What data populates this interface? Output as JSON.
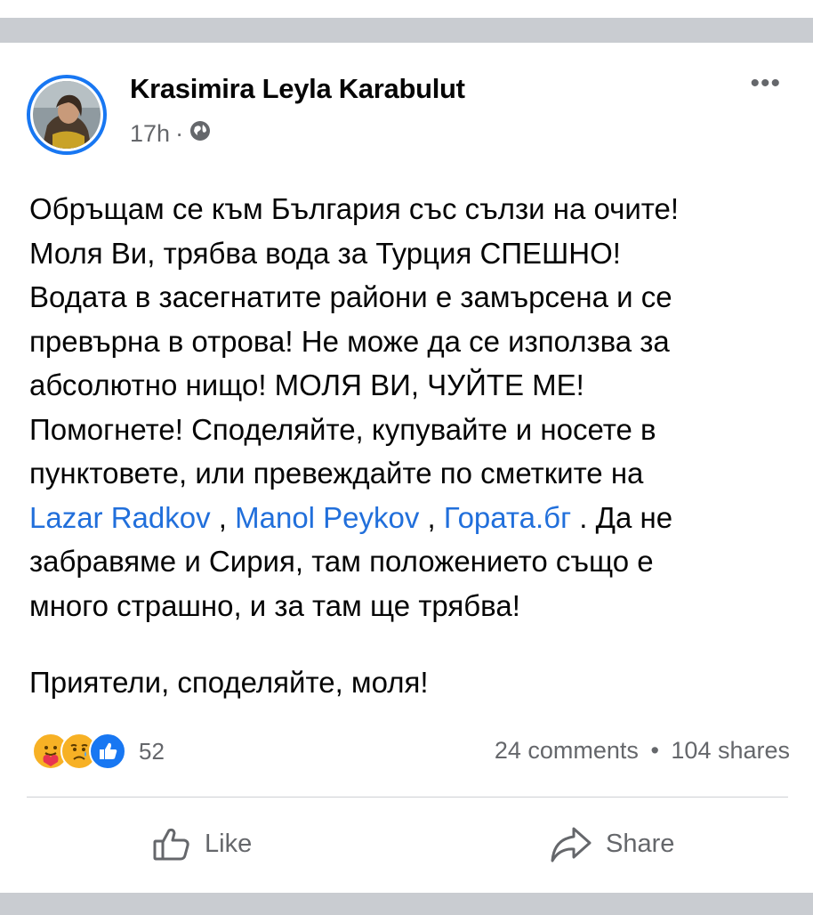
{
  "post": {
    "author": "Krasimira Leyla Karabulut",
    "time": "17h",
    "separator": "·",
    "privacy_icon": "globe-icon",
    "more_icon": "more-options-icon",
    "more_label": "•••",
    "body_lines": [
      "Обръщам се към България със сълзи на очите!",
      "Моля Ви, трябва вода за Турция СПЕШНО!",
      "Водата в засегнатите райони е замърсена и се",
      "превърна в отрова! Не може да се използва за",
      "абсолютно нищо! МОЛЯ ВИ, ЧУЙТЕ МЕ!",
      "Помогнете! Споделяйте, купувайте и носете в",
      "пунктовете, или превеждайте по сметките на"
    ],
    "mentions": [
      "Lazar Radkov",
      "Manol Peykov",
      "Гората.бг"
    ],
    "mention_sep1": " , ",
    "mention_sep2": "  , ",
    "after_mentions": " . Да не",
    "tail_lines": [
      "забравяме и Сирия, там положението също е",
      "много страшно, и за там ще трябва!"
    ],
    "closing": "Приятели, споделяйте, моля!"
  },
  "reactions": {
    "icons": [
      "care-icon",
      "sad-icon",
      "like-icon"
    ],
    "count": "52"
  },
  "stats": {
    "comments": "24 comments",
    "dot": "•",
    "shares": "104 shares"
  },
  "actions": {
    "like": "Like",
    "share": "Share"
  },
  "colors": {
    "link": "#216fdb",
    "accent": "#1877f2",
    "secondary_text": "#65676b",
    "band": "#c9ccd1"
  }
}
